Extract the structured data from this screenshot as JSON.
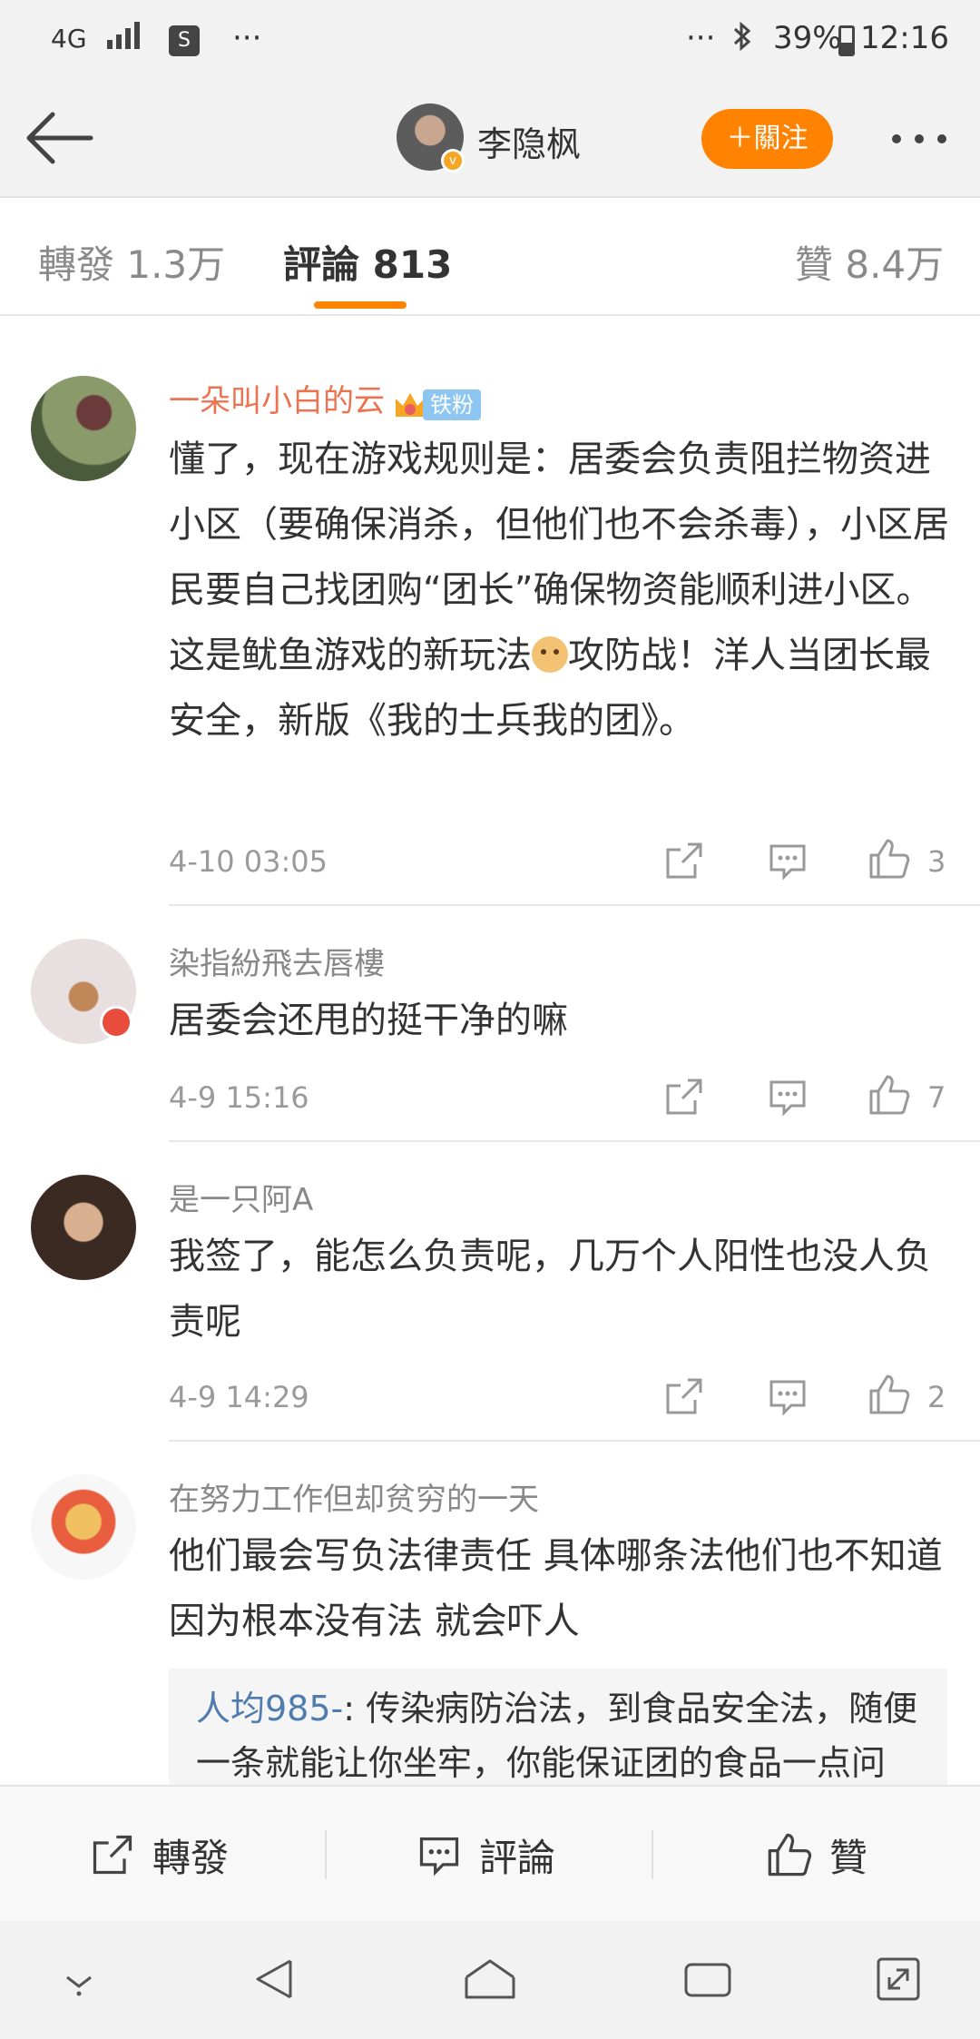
{
  "status_bar": {
    "network": "4G",
    "dots_left": "···",
    "dots_right": "···",
    "battery_percent": "39%",
    "time": "12:16"
  },
  "header": {
    "name": "李隐枫",
    "follow_label": "＋關注"
  },
  "tabs": [
    {
      "label": "轉發 1.3万"
    },
    {
      "label": "評論 813"
    },
    {
      "label": "贊 8.4万"
    }
  ],
  "comments": [
    {
      "user": "一朵叫小白的云",
      "fan_label": "铁粉",
      "text_a": "懂了，现在游戏规则是：居委会负责阻拦物资进小区（要确保消杀，但他们也不会杀毒），小区居民要自己找团购“团长”确保物资能顺利进小区。这是鱿鱼游戏的新玩法",
      "text_b": "攻防战！洋人当团长最安全，新版《我的士兵我的团》。",
      "time": "4-10 03:05",
      "likes": "3"
    },
    {
      "user": "染指紛飛去唇樓",
      "text": "居委会还甩的挺干净的嘛",
      "time": "4-9 15:16",
      "likes": "7"
    },
    {
      "user": "是一只阿A",
      "text": "我签了，能怎么负责呢，几万个人阳性也没人负责呢",
      "time": "4-9 14:29",
      "likes": "2"
    },
    {
      "user": "在努力工作但却贫穷的一天",
      "text": "他们最会写负法律责任 具体哪条法他们也不知道 因为根本没有法 就会吓人",
      "reply_user": "人均985-",
      "reply_text": ": 传染病防治法，到食品安全法，随便一条就能让你坐牢，你能保证团的食品一点问"
    }
  ],
  "bottom_bar": {
    "repost": "轉發",
    "comment": "評論",
    "like": "贊"
  },
  "colors": {
    "accent": "#ff8200",
    "username_highlight": "#eb7350",
    "reply_link": "#4f7cae"
  }
}
